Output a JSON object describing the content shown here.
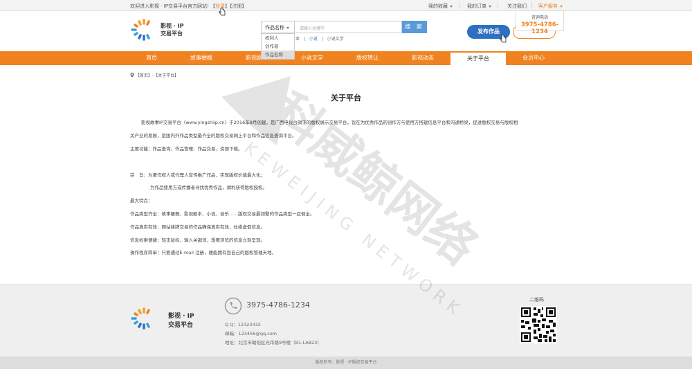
{
  "topbar": {
    "welcome": "欢迎进入影视 · IP交易平台官方网站!",
    "login_open": "【",
    "login_label": "登录",
    "login_mid": "】【",
    "register_label": "注册",
    "login_close": "】",
    "favorites": "我的收藏",
    "orders": "我的订单",
    "follow": "关注我们",
    "service": "客户服务"
  },
  "hotline_popup": {
    "title": "咨询电话",
    "number": "3975-4786-1234"
  },
  "header": {
    "logo_line1": "影视 · IP",
    "logo_line2": "交易平台",
    "search_select": "作品名称",
    "search_placeholder": "请输入关键字",
    "search_button": "搜 索",
    "dropdown_options": [
      "权利人",
      "创作者",
      "作品名称"
    ],
    "hot_words": [
      "本",
      "|",
      "小说",
      "|",
      "小说文学"
    ],
    "publish_button": "发布作品"
  },
  "nav": {
    "items": [
      "首页",
      "故事梗概",
      "影视剧本",
      "小说文学",
      "版权转让",
      "影视动态",
      "关于平台",
      "会员中心"
    ],
    "active_index": 6
  },
  "breadcrumb": "【首页】-【关于平台】",
  "page_title": "关于平台",
  "content": {
    "p1": "影视故事IP交易平台（www.yingshiip.cn）于2016年8月创建，是广西电视台旗下的版权展示交易平台，旨在为优秀作品的创作方与使用方搭建信息平台和沟通桥梁，促进版权交易与版权相",
    "p1b": "关产业的发展，是国内外作品类型最齐全的版权交易网上平台和作品信息查询平台。",
    "p2": "主要功能：作品查询、作品管理、作品交易、资源下载。",
    "p3a": "宗　旨：为著作权人或代理人宣传推广作品，实现版权价值最大化；",
    "p3b": "为作品使用方或传播者寻找优秀作品，顺利获得版权授权。",
    "p4": "最大特点：",
    "p5": "作品类型齐全：故事梗概、影视剧本、小说、音乐……版权交易最频繁的作品类型一应俱全。",
    "p6": "作品真实有效：网站挂牌交易的作品确保真实有效，杜绝虚假信息。",
    "p7": "信息检索便捷：轻击鼠标，输入关键词，想要浏览的信息立刻呈现。",
    "p8": "操作程序简单：只要通过E-mail 注册，便能拥有您自己的版权管理天地。"
  },
  "footer": {
    "logo_line1": "影视 · IP",
    "logo_line2": "交易平台",
    "phone": "3975-4786-1234",
    "qq": "Q Q：12323432",
    "email": "邮箱：123456@qq.com",
    "address": "地址：北京市朝阳区光华路9号楼（B1-LA823）",
    "qr_title": "二维码",
    "copyright": "版权所有：影视 · IP版权交易平台"
  },
  "watermark": {
    "cn": "科威鲸网络",
    "en": "KEWEIJING NETWORK"
  },
  "colors": {
    "brand_orange": "#f08220",
    "brand_blue": "#2f6fc0",
    "search_blue": "#5a9ad8"
  }
}
